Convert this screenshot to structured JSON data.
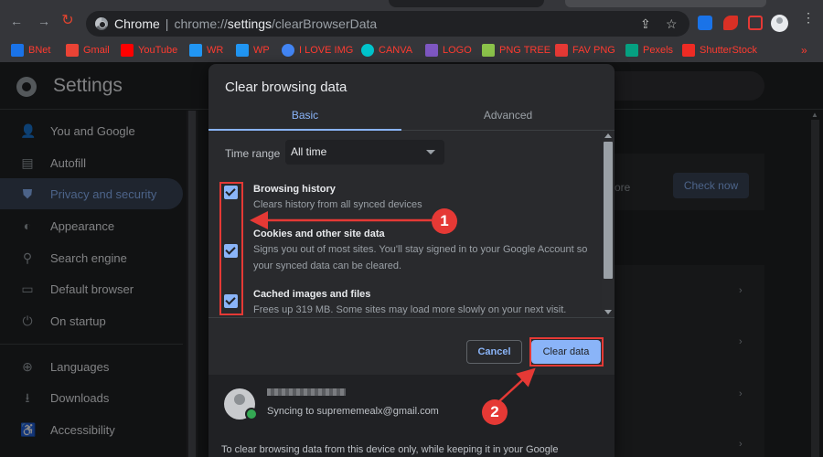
{
  "browser": {
    "omnibox": {
      "site_label": "Chrome",
      "url_prefix": "chrome://",
      "url_host": "settings",
      "url_path": "/clearBrowserData"
    },
    "bookmarks": [
      {
        "label": "BNet",
        "color": "#1a73e8"
      },
      {
        "label": "Gmail",
        "color": "#ea4335"
      },
      {
        "label": "YouTube",
        "color": "#ff0000"
      },
      {
        "label": "WR",
        "color": "#2196f3"
      },
      {
        "label": "WP",
        "color": "#2196f3"
      },
      {
        "label": "I LOVE IMG",
        "color": "#4285f4"
      },
      {
        "label": "CANVA",
        "color": "#00c4cc"
      },
      {
        "label": "LOGO",
        "color": "#7e57c2"
      },
      {
        "label": "PNG TREE",
        "color": "#8bc34a"
      },
      {
        "label": "FAV PNG",
        "color": "#e53935"
      },
      {
        "label": "Pexels",
        "color": "#05a081"
      },
      {
        "label": "ShutterStock",
        "color": "#ee2b24"
      }
    ],
    "bookmarks_more": "»"
  },
  "settings": {
    "title": "Settings",
    "sidebar": [
      {
        "label": "You and Google",
        "icon": "person-icon"
      },
      {
        "label": "Autofill",
        "icon": "clipboard-icon"
      },
      {
        "label": "Privacy and security",
        "icon": "shield-icon"
      },
      {
        "label": "Appearance",
        "icon": "palette-icon"
      },
      {
        "label": "Search engine",
        "icon": "search-icon"
      },
      {
        "label": "Default browser",
        "icon": "browser-icon"
      },
      {
        "label": "On startup",
        "icon": "power-icon"
      },
      {
        "label": "Languages",
        "icon": "globe-icon"
      },
      {
        "label": "Downloads",
        "icon": "download-icon"
      },
      {
        "label": "Accessibility",
        "icon": "accessibility-icon"
      }
    ],
    "main": {
      "partial_text": "ore",
      "check_now_label": "Check now"
    }
  },
  "dialog": {
    "title": "Clear browsing data",
    "tabs": [
      "Basic",
      "Advanced"
    ],
    "time_range_label": "Time range",
    "time_range_value": "All time",
    "items": [
      {
        "title": "Browsing history",
        "desc": "Clears history from all synced devices",
        "checked": true
      },
      {
        "title": "Cookies and other site data",
        "desc": "Signs you out of most sites. You'll stay signed in to your Google Account so your synced data can be cleared.",
        "checked": true
      },
      {
        "title": "Cached images and files",
        "desc": "Frees up 319 MB. Some sites may load more slowly on your next visit.",
        "checked": true
      }
    ],
    "cancel_label": "Cancel",
    "clear_label": "Clear data",
    "account": {
      "syncing_text": "Syncing to suprememealx@gmail.com",
      "note": "To clear browsing data from this device only, while keeping it in your Google"
    }
  },
  "annotations": {
    "badge_1": "1",
    "badge_2": "2",
    "color": "#e53935"
  }
}
